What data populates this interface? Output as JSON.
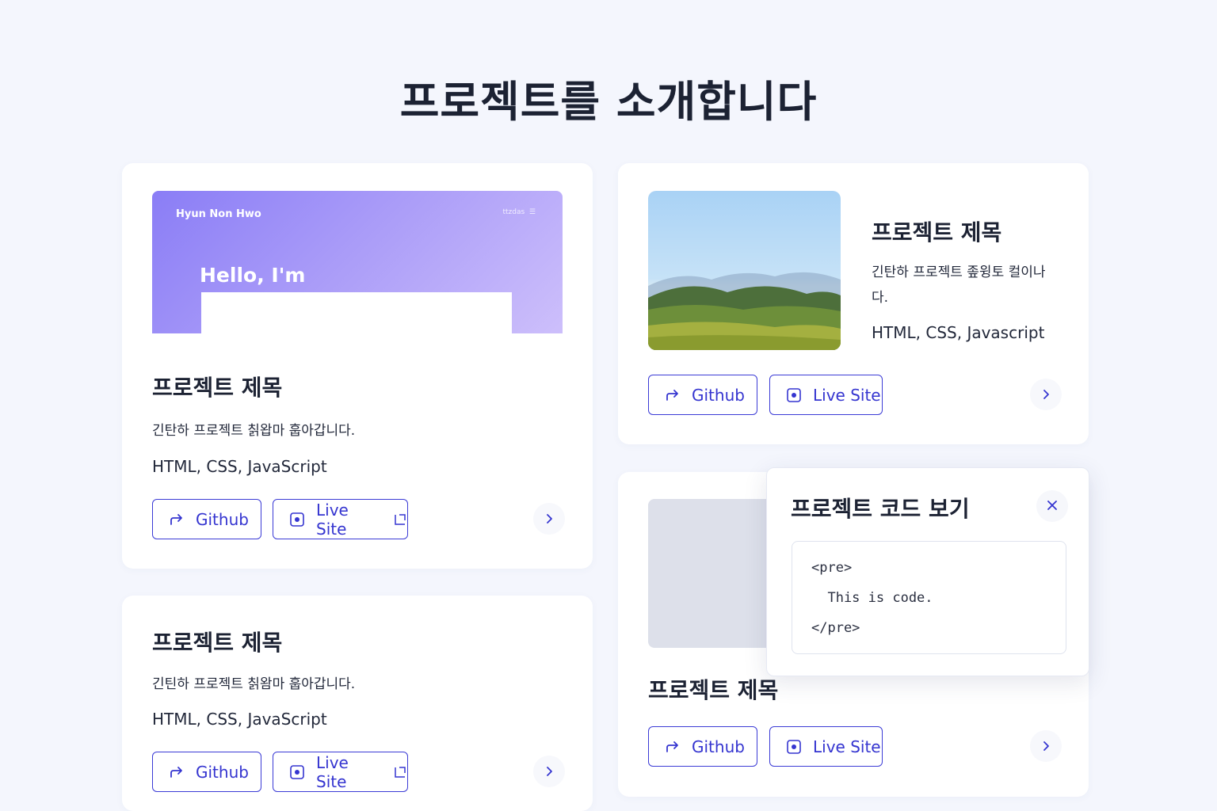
{
  "page": {
    "title": "프로젝트를 소개합니다"
  },
  "colors": {
    "accent": "#3b3bd6",
    "background": "#f4f6fd",
    "preview_gradient_start": "#8a7df6",
    "preview_gradient_end": "#cdbffb"
  },
  "cards": [
    {
      "preview": {
        "brand": "Hyun Non Hwo",
        "nav": "ttzdas",
        "hello": "Hello, I'm"
      },
      "title": "프로젝트 제목",
      "description": "긴탄하 프로젝트 칡왑마 훕아갑니다.",
      "tech": "HTML, CSS, JavaScript",
      "github_label": "Github",
      "live_label": "Live Site"
    },
    {
      "title": "프로젝트 제목",
      "description": "긴탄하 프로젝트 좊윙토 컬이나다.",
      "tech": "HTML, CSS, Javascript",
      "github_label": "Github",
      "live_label": "Live Site"
    },
    {
      "title": "프로젝트 제목",
      "description": "긴틴하 프로젝트 칡왐마 훕아갑니다.",
      "tech": "HTML, CSS, JavaScript",
      "github_label": "Github",
      "live_label": "Live Site"
    },
    {
      "title": "프로젝트 제목",
      "github_label": "Github",
      "live_label": "Live Site"
    }
  ],
  "modal": {
    "title": "프로젝트 코드 보기",
    "code_lines": [
      "<pre>",
      "  This is code.",
      "</pre>"
    ]
  }
}
